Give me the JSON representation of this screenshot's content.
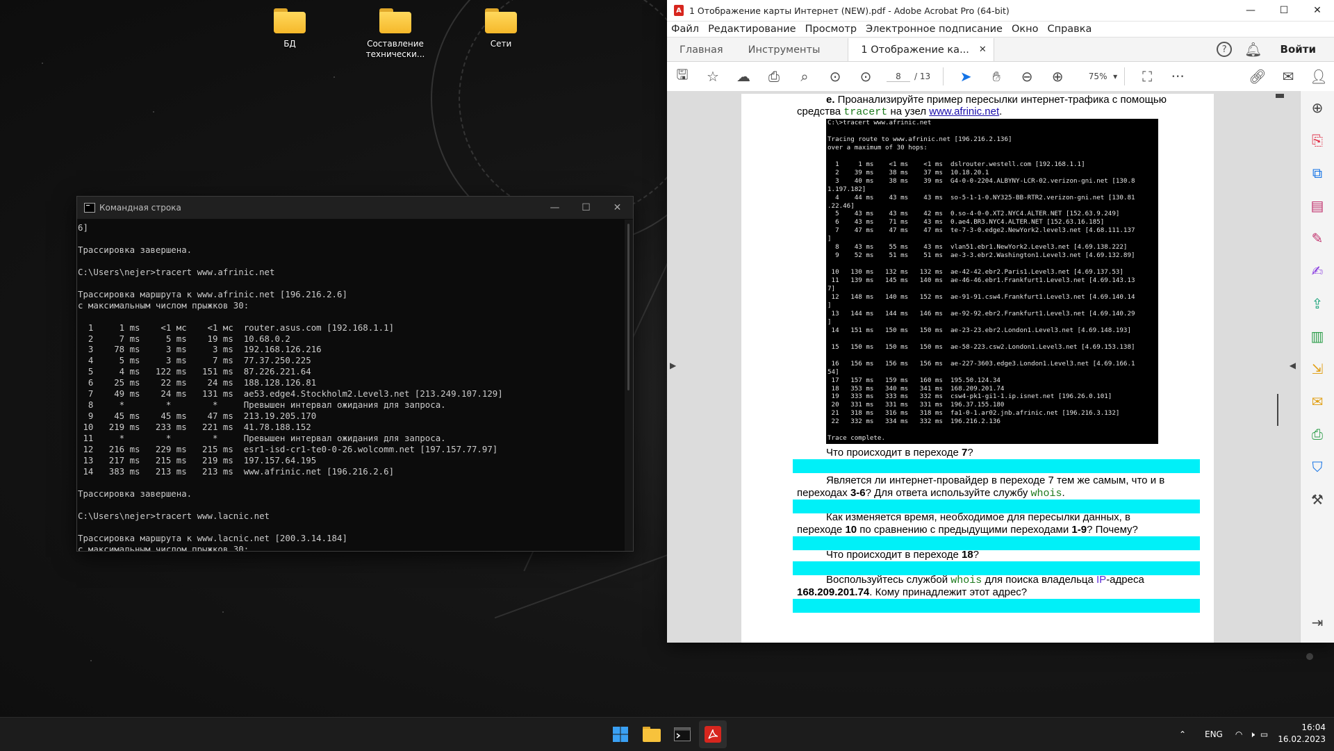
{
  "desktop": {
    "icons": [
      {
        "label": "БД"
      },
      {
        "label": "Составление технически..."
      },
      {
        "label": "Сети"
      }
    ]
  },
  "cmd": {
    "title": "Командная строка",
    "lines": [
      "6]",
      "",
      "Трассировка завершена.",
      "",
      "C:\\Users\\nejer>tracert www.afrinic.net",
      "",
      "Трассировка маршрута к www.afrinic.net [196.216.2.6]",
      "с максимальным числом прыжков 30:",
      "",
      "  1     1 ms    <1 мс    <1 мс  router.asus.com [192.168.1.1]",
      "  2     7 ms     5 ms    19 ms  10.68.0.2",
      "  3    78 ms     3 ms     3 ms  192.168.126.216",
      "  4     5 ms     3 ms     7 ms  77.37.250.225",
      "  5     4 ms   122 ms   151 ms  87.226.221.64",
      "  6    25 ms    22 ms    24 ms  188.128.126.81",
      "  7    49 ms    24 ms   131 ms  ae53.edge4.Stockholm2.Level3.net [213.249.107.129]",
      "  8     *        *        *     Превышен интервал ожидания для запроса.",
      "  9    45 ms    45 ms    47 ms  213.19.205.170",
      " 10   219 ms   233 ms   221 ms  41.78.188.152",
      " 11     *        *        *     Превышен интервал ожидания для запроса.",
      " 12   216 ms   229 ms   215 ms  esr1-isd-cr1-te0-0-26.wolcomm.net [197.157.77.97]",
      " 13   217 ms   215 ms   219 ms  197.157.64.195",
      " 14   383 ms   213 ms   213 ms  www.afrinic.net [196.216.2.6]",
      "",
      "Трассировка завершена.",
      "",
      "C:\\Users\\nejer>tracert www.lacnic.net",
      "",
      "Трассировка маршрута к www.lacnic.net [200.3.14.184]",
      "с максимальным числом прыжков 30:"
    ]
  },
  "acrobat": {
    "title": "1 Отображение карты Интернет (NEW).pdf - Adobe Acrobat Pro (64-bit)",
    "menu": [
      "Файл",
      "Редактирование",
      "Просмотр",
      "Электронное подписание",
      "Окно",
      "Справка"
    ],
    "tabs": {
      "home": "Главная",
      "tools": "Инструменты",
      "doc": "1 Отображение ка..."
    },
    "login": "Войти",
    "page_current": "8",
    "page_total": "/ 13",
    "zoom": "75%",
    "doc": {
      "intro_bold": "e.",
      "intro_text": " Проанализируйте пример пересылки интернет-трафика с помощью",
      "intro2_a": "средства ",
      "intro2_code": "tracert",
      "intro2_b": " на узел ",
      "intro2_link": "www.afrinic.net",
      "intro2_c": ".",
      "terminal": [
        "C:\\>tracert www.afrinic.net",
        "",
        "Tracing route to www.afrinic.net [196.216.2.136]",
        "over a maximum of 30 hops:",
        "",
        "  1     1 ms    <1 ms    <1 ms  dslrouter.westell.com [192.168.1.1]",
        "  2    39 ms    38 ms    37 ms  10.18.20.1",
        "  3    40 ms    38 ms    39 ms  G4-0-0-2204.ALBYNY-LCR-02.verizon-gni.net [130.8",
        "1.197.182]",
        "  4    44 ms    43 ms    43 ms  so-5-1-1-0.NY325-BB-RTR2.verizon-gni.net [130.81",
        ".22.46]",
        "  5    43 ms    43 ms    42 ms  0.so-4-0-0.XT2.NYC4.ALTER.NET [152.63.9.249]",
        "  6    43 ms    71 ms    43 ms  0.ae4.BR3.NYC4.ALTER.NET [152.63.16.185]",
        "  7    47 ms    47 ms    47 ms  te-7-3-0.edge2.NewYork2.level3.net [4.68.111.137",
        "]",
        "  8    43 ms    55 ms    43 ms  vlan51.ebr1.NewYork2.Level3.net [4.69.138.222]",
        "  9    52 ms    51 ms    51 ms  ae-3-3.ebr2.Washington1.Level3.net [4.69.132.89]",
        "",
        " 10   130 ms   132 ms   132 ms  ae-42-42.ebr2.Paris1.Level3.net [4.69.137.53]",
        " 11   139 ms   145 ms   140 ms  ae-46-46.ebr1.Frankfurt1.Level3.net [4.69.143.13",
        "7]",
        " 12   148 ms   140 ms   152 ms  ae-91-91.csw4.Frankfurt1.Level3.net [4.69.140.14",
        "]",
        " 13   144 ms   144 ms   146 ms  ae-92-92.ebr2.Frankfurt1.Level3.net [4.69.140.29",
        "]",
        " 14   151 ms   150 ms   150 ms  ae-23-23.ebr2.London1.Level3.net [4.69.148.193]",
        "",
        " 15   150 ms   150 ms   150 ms  ae-58-223.csw2.London1.Level3.net [4.69.153.138]",
        "",
        " 16   156 ms   156 ms   156 ms  ae-227-3603.edge3.London1.Level3.net [4.69.166.1",
        "54]",
        " 17   157 ms   159 ms   160 ms  195.50.124.34",
        " 18   353 ms   340 ms   341 ms  168.209.201.74",
        " 19   333 ms   333 ms   332 ms  csw4-pk1-gi1-1.ip.isnet.net [196.26.0.101]",
        " 20   331 ms   331 ms   331 ms  196.37.155.180",
        " 21   318 ms   316 ms   318 ms  fa1-0-1.ar02.jnb.afrinic.net [196.216.3.132]",
        " 22   332 ms   334 ms   332 ms  196.216.2.136",
        "",
        "Trace complete."
      ],
      "q1_a": "Что происходит в переходе ",
      "q1_b": "7",
      "q1_c": "?",
      "q2_a": "Является ли интернет-провайдер в переходе 7 тем же самым, что и в",
      "q2_b": "переходах ",
      "q2_c": "3-6",
      "q2_d": "? Для ответа используйте службу ",
      "q2_code": "whois",
      "q2_e": ".",
      "q3_a": "Как изменяется время, необходимое для пересылки данных, в",
      "q3_b": "переходе ",
      "q3_c": "10",
      "q3_d": " по сравнению с предыдущими переходами ",
      "q3_e": "1-9",
      "q3_f": "? Почему?",
      "q4_a": "Что происходит в переходе ",
      "q4_b": "18",
      "q4_c": "?",
      "q5_a": "Воспользуйтесь службой ",
      "q5_code": "whois",
      "q5_b": " для поиска владельца ",
      "q5_ip": "IP",
      "q5_c": "-адреса",
      "q5_d": "168.209.201.74",
      "q5_e": ". Кому принадлежит этот адрес?"
    }
  },
  "taskbar": {
    "lang": "ENG",
    "time": "16:04",
    "date": "16.02.2023"
  },
  "colors": {
    "accent": "#1473e6",
    "highlight": "#00f0f8",
    "acrobat_red": "#d7261e"
  }
}
